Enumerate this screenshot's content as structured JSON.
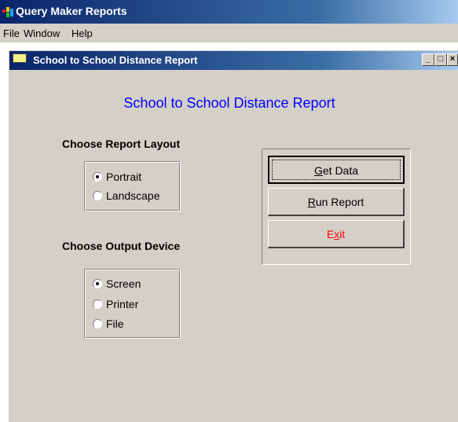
{
  "app": {
    "title": "Query Maker Reports"
  },
  "menu": {
    "items": [
      "File",
      "Window",
      "Help"
    ]
  },
  "child_window": {
    "title": "School to School Distance Report",
    "controls": {
      "minimize": "_",
      "restore": "□",
      "close": "×"
    }
  },
  "report": {
    "heading": "School to School Distance Report",
    "layout_label": "Choose Report Layout",
    "layout_options": [
      "Portrait",
      "Landscape"
    ],
    "layout_selected": "Portrait",
    "output_label": "Choose Output Device",
    "output_options": [
      "Screen",
      "Printer",
      "File"
    ],
    "output_selected": "Screen"
  },
  "buttons": {
    "get_data": {
      "pre": "",
      "mnemonic": "G",
      "post": "et Data"
    },
    "run_report": {
      "pre": "",
      "mnemonic": "R",
      "post": "un Report"
    },
    "exit": {
      "pre": "E",
      "mnemonic": "x",
      "post": "it"
    }
  },
  "colors": {
    "heading": "#0000ff",
    "exit_text": "#ff0000",
    "titlebar": "#0a246a"
  }
}
